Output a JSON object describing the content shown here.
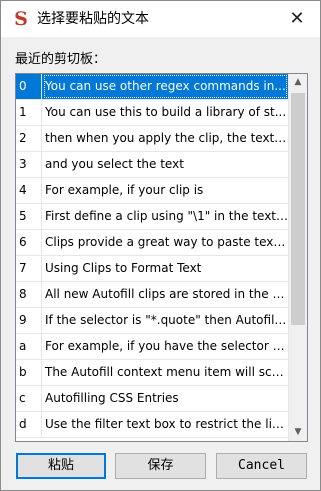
{
  "window": {
    "app_icon_glyph": "S",
    "title": "选择要粘贴的文本",
    "close_glyph": "✕"
  },
  "list": {
    "label": "最近的剪切板：",
    "selected_index": 0,
    "rows": [
      {
        "key": "0",
        "text": "You can use other regex commands in..."
      },
      {
        "key": "1",
        "text": "You can use this to build a library of st..."
      },
      {
        "key": "2",
        "text": "then when you apply the clip, the text ..."
      },
      {
        "key": "3",
        "text": "and you select the text"
      },
      {
        "key": "4",
        "text": "For example, if your clip is"
      },
      {
        "key": "5",
        "text": "First define a clip using \"\\1\" in the text...."
      },
      {
        "key": "6",
        "text": "Clips provide a great way to paste text..."
      },
      {
        "key": "7",
        "text": "Using Clips to Format Text"
      },
      {
        "key": "8",
        "text": "All new Autofill clips are stored in the \"..."
      },
      {
        "key": "9",
        "text": "If the selector is \"*.quote\" then Autofill ..."
      },
      {
        "key": "a",
        "text": "For example, if you have the selector o..."
      },
      {
        "key": "b",
        "text": "The Autofill context menu item will sca..."
      },
      {
        "key": "c",
        "text": "Autofilling CSS Entries"
      },
      {
        "key": "d",
        "text": "Use the filter text box to restrict the lis..."
      }
    ]
  },
  "scrollbar": {
    "up_glyph": "▲",
    "down_glyph": "▼"
  },
  "buttons": {
    "paste": "粘贴",
    "save": "保存",
    "cancel": "Cancel"
  }
}
